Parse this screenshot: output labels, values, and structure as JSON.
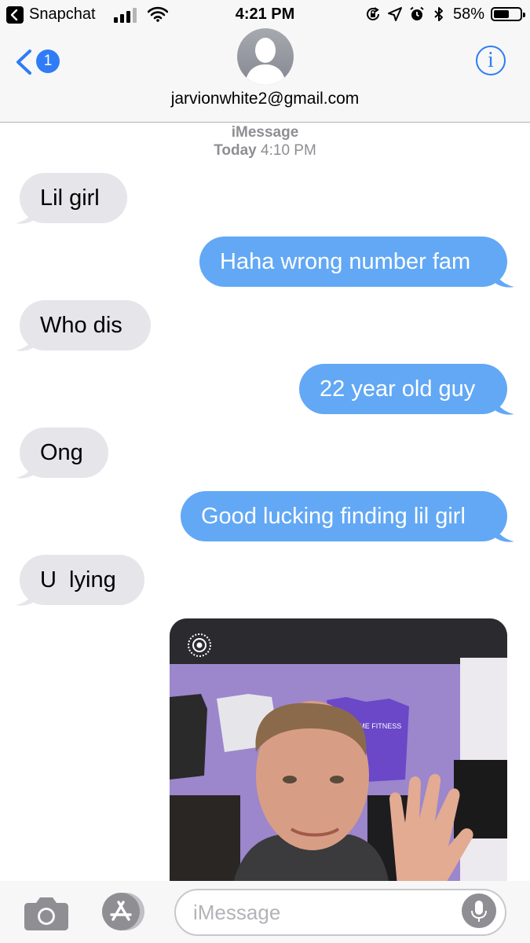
{
  "status_bar": {
    "back_app": "Snapchat",
    "time": "4:21 PM",
    "battery_percent": "58%",
    "battery_level": 0.58,
    "icons": [
      "back-to-app-icon",
      "cellular-signal-icon",
      "wifi-icon",
      "rotation-lock-icon",
      "location-icon",
      "alarm-icon",
      "bluetooth-icon",
      "battery-icon"
    ]
  },
  "header": {
    "back_badge": "1",
    "contact": "jarvionwhite2@gmail.com",
    "info_label": "i"
  },
  "conversation": {
    "service": "iMessage",
    "date_day": "Today",
    "date_time": "4:10 PM",
    "messages": [
      {
        "direction": "incoming",
        "text": "Lil girl"
      },
      {
        "direction": "outgoing",
        "text": "Haha wrong number fam"
      },
      {
        "direction": "incoming",
        "text": "Who dis"
      },
      {
        "direction": "outgoing",
        "text": "22 year old guy"
      },
      {
        "direction": "incoming",
        "text": "Ong"
      },
      {
        "direction": "outgoing",
        "text": "Good lucking finding lil girl"
      },
      {
        "direction": "incoming",
        "text": "U  lying"
      },
      {
        "direction": "outgoing",
        "type": "live-photo",
        "shirt_text": "ANYTIME FITNESS"
      }
    ]
  },
  "input_bar": {
    "placeholder": "iMessage"
  },
  "colors": {
    "incoming_bubble": "#e5e5ea",
    "outgoing_bubble": "#62a8f5",
    "accent": "#2f7cf6"
  }
}
